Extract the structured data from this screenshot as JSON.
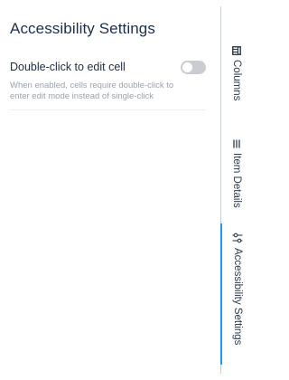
{
  "panel": {
    "title": "Accessibility Settings",
    "setting": {
      "label": "Double-click to edit cell",
      "description": "When enabled, cells require double-click to enter edit mode instead of single-click",
      "toggle_on": false
    }
  },
  "sidebar": {
    "tabs": [
      {
        "label": "Columns",
        "icon": "columns-icon",
        "active": false
      },
      {
        "label": "Item Details",
        "icon": "list-icon",
        "active": false
      },
      {
        "label": "Accessibility Settings",
        "icon": "sliders-icon",
        "active": true
      }
    ]
  },
  "colors": {
    "accent": "#2196f3",
    "title": "#1c2f4a",
    "toggle_off": "#c9cdd1"
  }
}
